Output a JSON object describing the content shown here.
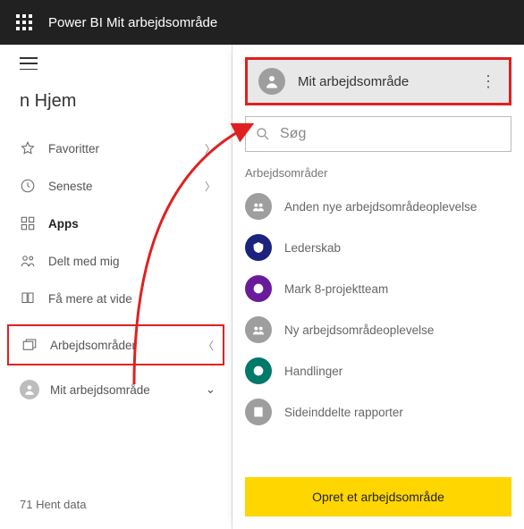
{
  "topbar": {
    "title": "Power BI Mit arbejdsområde"
  },
  "sidebar": {
    "home": "n Hjem",
    "items": [
      {
        "label": "Favoritter",
        "chev": true
      },
      {
        "label": "Seneste",
        "chev": true
      },
      {
        "label": "Apps",
        "chev": false,
        "bold": true
      },
      {
        "label": "Delt med mig",
        "chev": false
      },
      {
        "label": "Få mere at vide",
        "chev": false
      }
    ],
    "workspaces_label": "Arbejdsområder",
    "my_workspace": "Mit arbejdsområde",
    "get_data": "71 Hent data"
  },
  "flyout": {
    "current": "Mit arbejdsområde",
    "search_placeholder": "Søg",
    "section": "Arbejdsområder",
    "items": [
      {
        "label": "Anden nye arbejdsområdeoplevelse",
        "color": "gray"
      },
      {
        "label": "Lederskab",
        "color": "navy"
      },
      {
        "label": "Mark 8-projektteam",
        "color": "purple"
      },
      {
        "label": "Ny arbejdsområdeoplevelse",
        "color": "gray"
      },
      {
        "label": "Handlinger",
        "color": "teal"
      },
      {
        "label": "Sideinddelte rapporter",
        "color": "gray"
      }
    ],
    "create": "Opret et arbejdsområde"
  }
}
